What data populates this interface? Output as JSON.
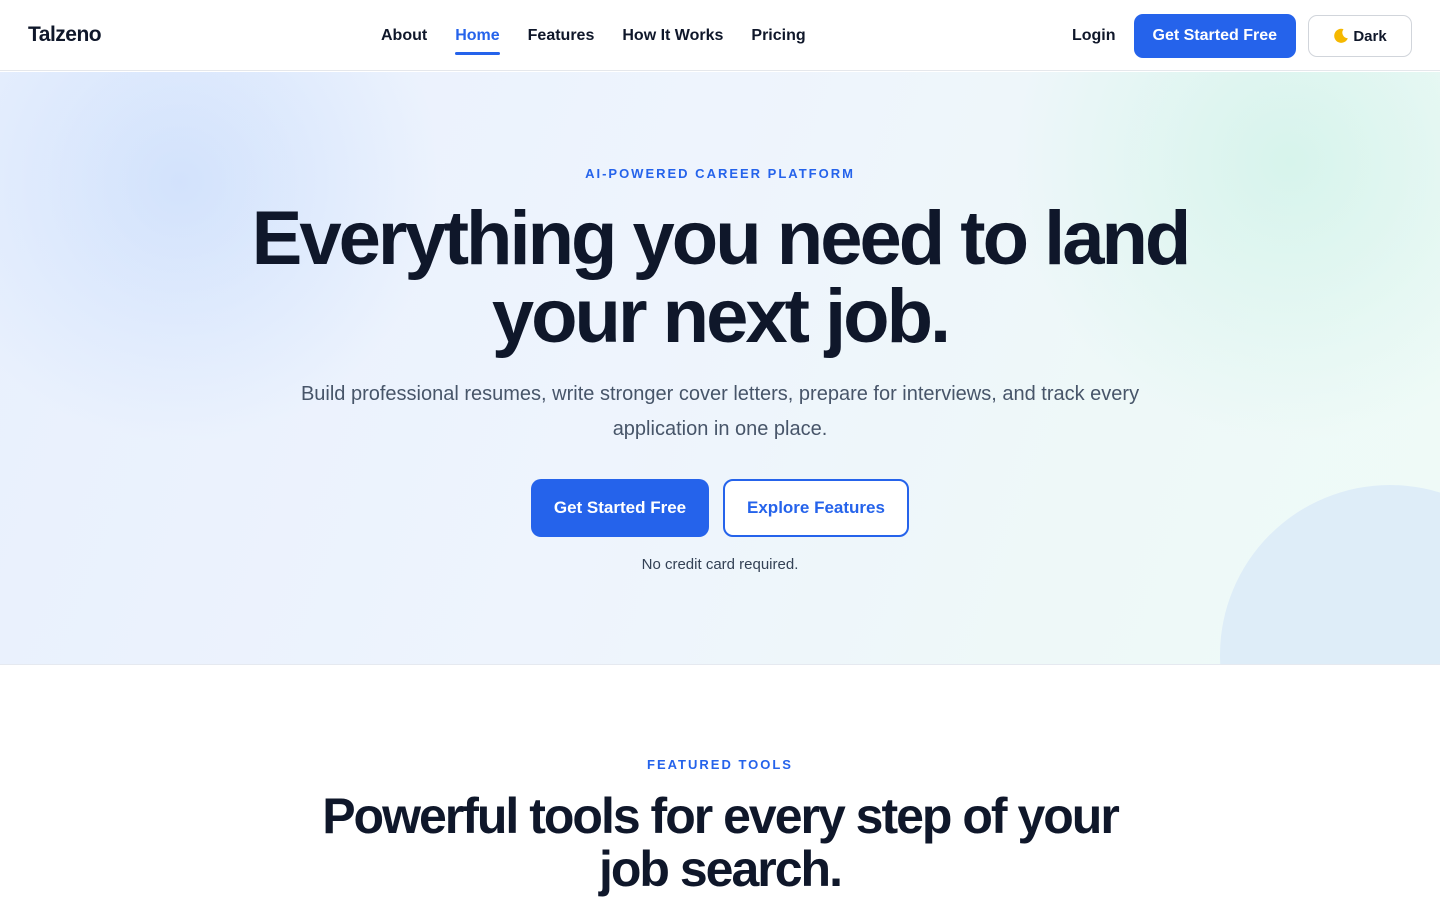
{
  "brand": {
    "name": "Talzeno"
  },
  "nav": {
    "items": [
      {
        "label": "About"
      },
      {
        "label": "Home",
        "active": true
      },
      {
        "label": "Features"
      },
      {
        "label": "How It Works"
      },
      {
        "label": "Pricing"
      }
    ]
  },
  "header": {
    "login_label": "Login",
    "cta_label": "Get Started Free",
    "theme_label": "Dark",
    "theme_icon": "moon-icon"
  },
  "hero": {
    "eyebrow": "AI-POWERED CAREER PLATFORM",
    "title": "Everything you need to land your next job.",
    "subtitle": "Build professional resumes, write stronger cover letters, prepare for interviews, and track every application in one place.",
    "primary_cta": "Get Started Free",
    "secondary_cta": "Explore Features",
    "note": "No credit card required."
  },
  "featured": {
    "eyebrow": "FEATURED TOOLS",
    "title": "Powerful tools for every step of your job search."
  },
  "colors": {
    "accent": "#2563eb",
    "text": "#0f172a",
    "muted": "#475569"
  }
}
